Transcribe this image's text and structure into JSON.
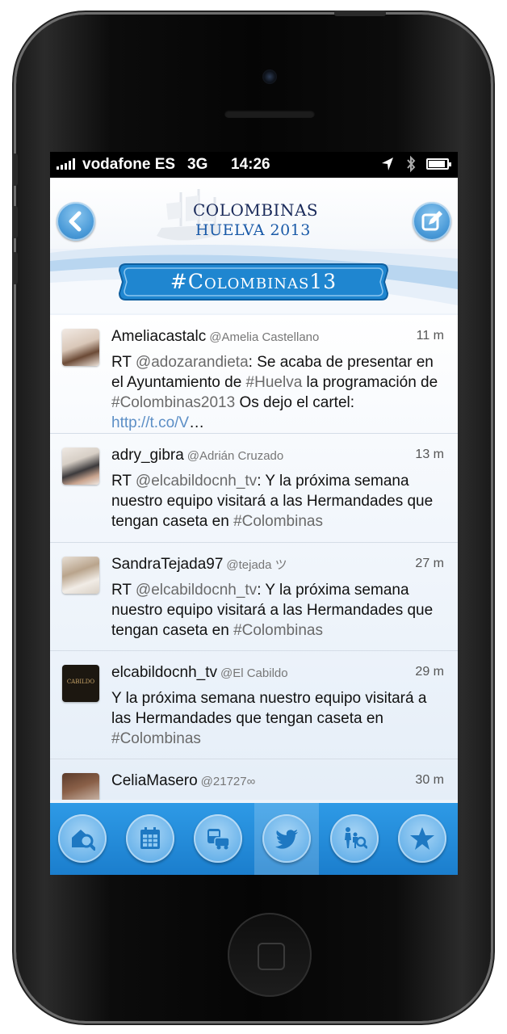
{
  "statusbar": {
    "carrier": "vodafone ES",
    "network": "3G",
    "time": "14:26"
  },
  "header": {
    "logo_line1": "COLOMBINAS",
    "logo_line2": "HUELVA 2013",
    "hashtag_banner": "#Colombinas13"
  },
  "tweets": [
    {
      "user": "Ameliacastalc",
      "handle": "@Amelia Castellano",
      "time": "11 m",
      "body": [
        {
          "t": "RT ",
          "s": ""
        },
        {
          "t": "@adozarandieta",
          "s": "hl"
        },
        {
          "t": ": Se acaba de presentar en el Ayuntamiento de ",
          "s": ""
        },
        {
          "t": "#Huelva",
          "s": "hl"
        },
        {
          "t": " la programación de ",
          "s": ""
        },
        {
          "t": "#Colombinas2013",
          "s": "hl"
        },
        {
          "t": " Os dejo el cartel: ",
          "s": ""
        },
        {
          "t": "http://t.co/V",
          "s": "lnk"
        },
        {
          "t": "…",
          "s": ""
        }
      ],
      "avatar": "amelia-avatar"
    },
    {
      "user": "adry_gibra",
      "handle": "@Adrián Cruzado",
      "time": "13 m",
      "body": [
        {
          "t": "RT ",
          "s": ""
        },
        {
          "t": "@elcabildocnh_tv",
          "s": "hl"
        },
        {
          "t": ": Y la próxima semana nuestro equipo visitará a las Hermandades que tengan caseta en ",
          "s": ""
        },
        {
          "t": "#Colombinas",
          "s": "hl"
        }
      ],
      "avatar": "adry-avatar"
    },
    {
      "user": "SandraTejada97",
      "handle": "@tejada ツ",
      "time": "27 m",
      "body": [
        {
          "t": "RT ",
          "s": ""
        },
        {
          "t": "@elcabildocnh_tv",
          "s": "hl"
        },
        {
          "t": ": Y la próxima semana nuestro equipo visitará a las Hermandades que tengan caseta en ",
          "s": ""
        },
        {
          "t": "#Colombinas",
          "s": "hl"
        }
      ],
      "avatar": "sandra-avatar"
    },
    {
      "user": "elcabildocnh_tv",
      "handle": "@El Cabildo",
      "time": "29 m",
      "body": [
        {
          "t": "Y la próxima semana nuestro equipo visitará a las Hermandades que tengan caseta en ",
          "s": ""
        },
        {
          "t": "#Colombinas",
          "s": "hl"
        }
      ],
      "avatar": "cabildo-avatar",
      "avatar_text": "CABILDO"
    },
    {
      "user": "CeliaMasero",
      "handle": "@21727∞",
      "time": "30 m",
      "body": [],
      "avatar": "celia-avatar"
    }
  ],
  "tabs": [
    {
      "name": "search-place",
      "icon": "house-search-icon",
      "active": false
    },
    {
      "name": "calendar",
      "icon": "calendar-icon",
      "active": false
    },
    {
      "name": "transport",
      "icon": "bus-car-icon",
      "active": false
    },
    {
      "name": "twitter",
      "icon": "twitter-bird-icon",
      "active": true
    },
    {
      "name": "kids",
      "icon": "family-search-icon",
      "active": false
    },
    {
      "name": "favorites",
      "icon": "star-icon",
      "active": false
    }
  ],
  "colors": {
    "accent": "#2e9ae6",
    "hashtag": "#6a6a6a",
    "link": "#5d8fc6"
  }
}
